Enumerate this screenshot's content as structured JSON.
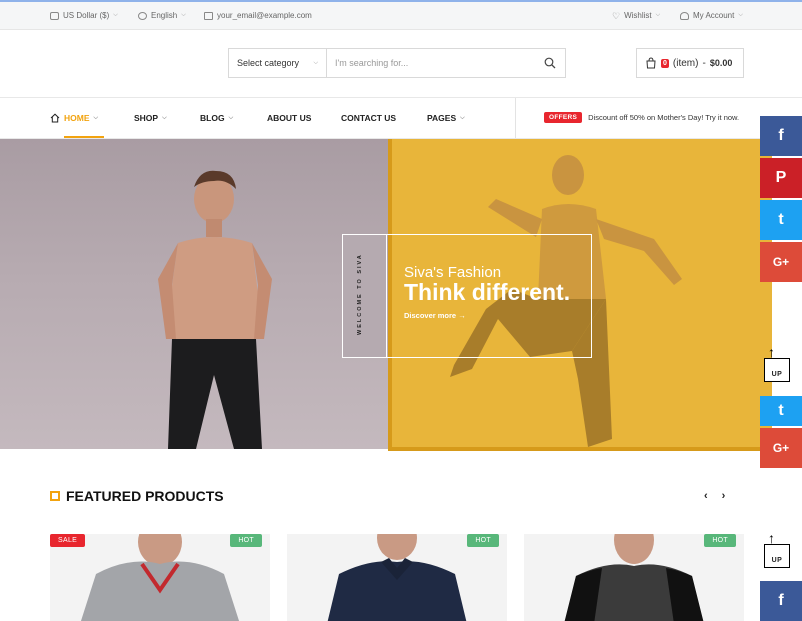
{
  "topbar": {
    "currency": "US Dollar ($)",
    "language": "English",
    "email": "your_email@example.com",
    "wishlist": "Wishlist",
    "account": "My Account"
  },
  "search": {
    "category": "Select category",
    "placeholder": "I'm searching for..."
  },
  "cart": {
    "count": "0",
    "items_label": "(item)",
    "separator": "-",
    "total": "$0.00"
  },
  "nav": {
    "items": [
      {
        "label": "HOME",
        "has_dropdown": true,
        "active": true
      },
      {
        "label": "SHOP",
        "has_dropdown": true
      },
      {
        "label": "BLOG",
        "has_dropdown": true
      },
      {
        "label": "ABOUT US",
        "has_dropdown": false
      },
      {
        "label": "CONTACT US",
        "has_dropdown": false
      },
      {
        "label": "PAGES",
        "has_dropdown": true
      }
    ],
    "offer_badge": "OFFERS",
    "offer_text": "Discount off 50% on Mother's Day! Try it now."
  },
  "hero": {
    "vertical": "WELCOME TO SIVA",
    "subtitle": "Siva's Fashion",
    "title": "Think different.",
    "link": "Discover more →"
  },
  "featured": {
    "title": "FEATURED PRODUCTS",
    "prev": "‹",
    "next": "›"
  },
  "products": [
    {
      "badge_left": "SALE",
      "badge_right": "HOT",
      "shirt_color": "#9ea0a4"
    },
    {
      "badge_right": "HOT",
      "shirt_color": "#1f2a44"
    },
    {
      "badge_right": "HOT",
      "shirt_color": "#3a3a3a"
    }
  ],
  "social": {
    "facebook": "f",
    "pinterest": "P",
    "twitter": "t",
    "google": "G+",
    "up": "UP"
  },
  "colors": {
    "accent": "#f2a30f",
    "sale": "#e8262e",
    "hot": "#58b77a",
    "facebook": "#3b5998",
    "pinterest": "#cb2027",
    "twitter": "#1da1f2",
    "google": "#dd4b39",
    "hero_yellow": "#e8b53a"
  }
}
